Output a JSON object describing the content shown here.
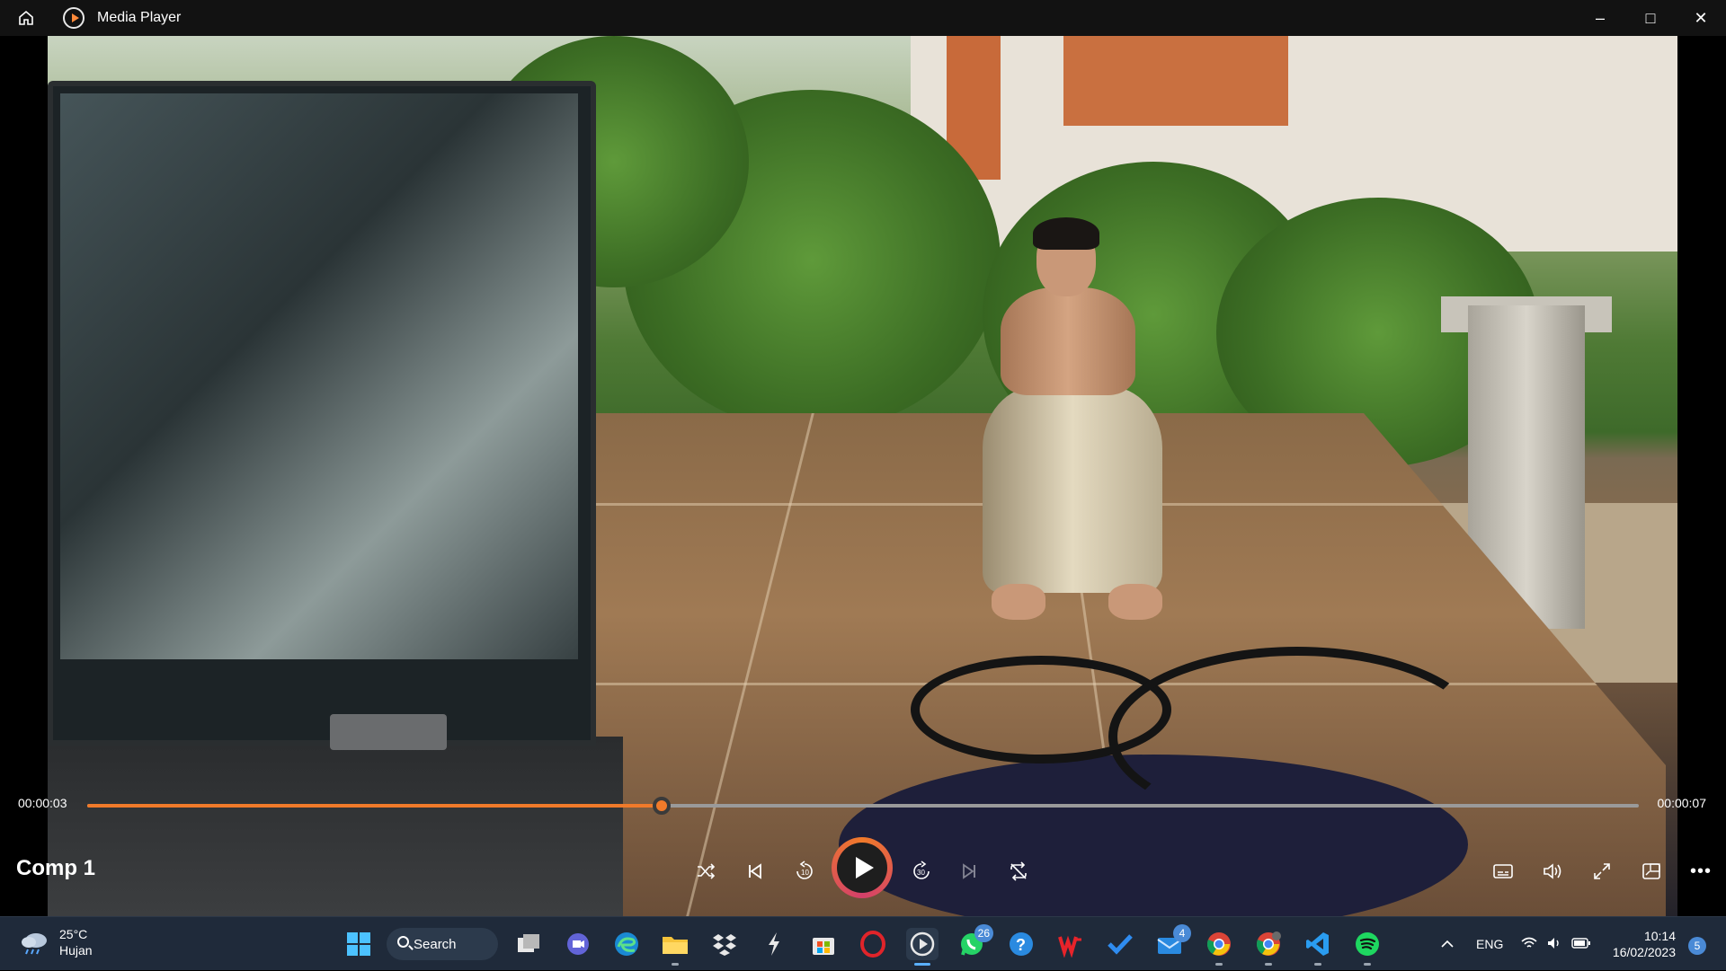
{
  "window": {
    "title": "Media Player",
    "controls": {
      "minimize": "–",
      "maximize": "□",
      "close": "✕"
    }
  },
  "player": {
    "current_time": "00:00:03",
    "total_time": "00:00:07",
    "progress_fraction": 0.37,
    "media_title": "Comp 1",
    "accent_color": "#f07a2a"
  },
  "taskbar": {
    "weather": {
      "temp": "25°C",
      "condition": "Hujan"
    },
    "search_label": "Search",
    "apps": [
      {
        "name": "Windows Start",
        "icon": "windows-icon"
      },
      {
        "name": "Task View",
        "icon": "task-view-icon"
      },
      {
        "name": "Teams Meet",
        "icon": "meet-icon"
      },
      {
        "name": "Edge",
        "icon": "edge-icon"
      },
      {
        "name": "File Explorer",
        "icon": "folder-icon"
      },
      {
        "name": "Dropbox",
        "icon": "dropbox-icon"
      },
      {
        "name": "Lightning",
        "icon": "lightning-icon"
      },
      {
        "name": "Microsoft Store",
        "icon": "store-icon"
      },
      {
        "name": "Opera",
        "icon": "opera-icon"
      },
      {
        "name": "Media Player",
        "icon": "media-player-icon"
      },
      {
        "name": "WhatsApp",
        "icon": "whatsapp-icon",
        "badge": "26"
      },
      {
        "name": "Help",
        "icon": "help-icon"
      },
      {
        "name": "WPS",
        "icon": "wps-icon"
      },
      {
        "name": "To Do",
        "icon": "todo-icon"
      },
      {
        "name": "Mail",
        "icon": "mail-icon",
        "badge": "4"
      },
      {
        "name": "Chrome",
        "icon": "chrome-icon"
      },
      {
        "name": "Chrome Profile",
        "icon": "chrome-profile-icon"
      },
      {
        "name": "VS Code",
        "icon": "vscode-icon"
      },
      {
        "name": "Spotify",
        "icon": "spotify-icon"
      }
    ],
    "language": "ENG",
    "time": "10:14",
    "date": "16/02/2023",
    "notification_count": "5"
  }
}
